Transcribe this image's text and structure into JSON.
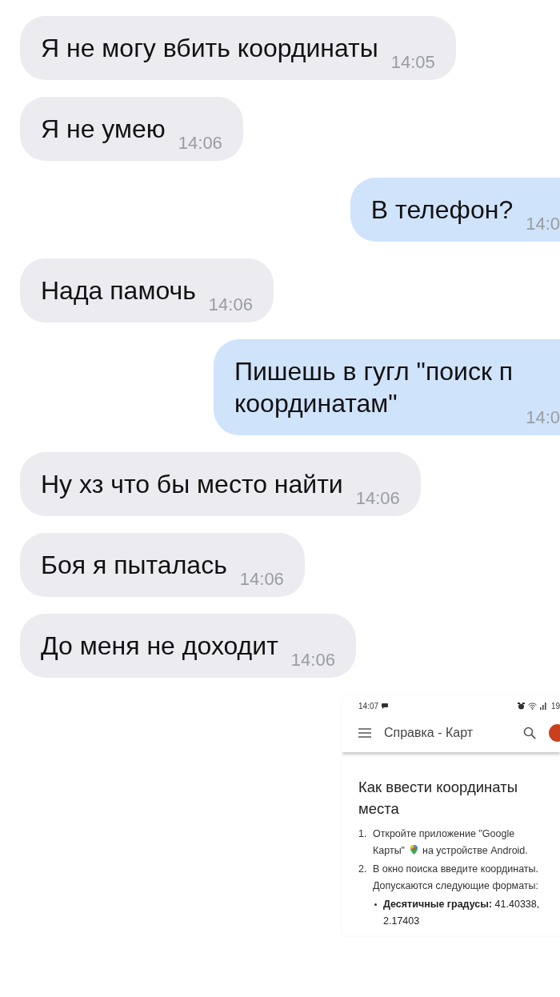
{
  "messages": [
    {
      "kind": "incoming",
      "lines": [
        "Я не могу вбить координаты"
      ],
      "time": "14:05"
    },
    {
      "kind": "incoming",
      "lines": [
        "Я не умею"
      ],
      "time": "14:06"
    },
    {
      "kind": "outgoing",
      "lines": [
        "В телефон?"
      ],
      "time": "14:0"
    },
    {
      "kind": "incoming",
      "lines": [
        "Нада памочь"
      ],
      "time": "14:06"
    },
    {
      "kind": "outgoing",
      "lines": [
        "Пишешь в гугл \"поиск п",
        "координатам\""
      ],
      "time": "14:0"
    },
    {
      "kind": "incoming",
      "lines": [
        "Ну хз что бы место найти"
      ],
      "time": "14:06"
    },
    {
      "kind": "incoming",
      "lines": [
        "Боя я пыталась"
      ],
      "time": "14:06"
    },
    {
      "kind": "incoming",
      "lines": [
        "До меня не доходит"
      ],
      "time": "14:06"
    }
  ],
  "attachment": {
    "kind": "screenshot",
    "status_bar": {
      "time": "14:07",
      "battery": "19"
    },
    "app_bar": {
      "title": "Справка - Карт"
    },
    "article": {
      "title": "Как ввести координаты места",
      "steps": [
        {
          "number": "1.",
          "text": "Откройте приложение \"Google",
          "text_before_icon": "Карты\"",
          "text_after_icon": "на устройстве Android."
        },
        {
          "number": "2.",
          "text": "В окно поиска введите координаты. Допускаются следующие форматы:",
          "bullets": [
            "**Десятичные градусы:** 41.40338, 2.17403"
          ]
        }
      ]
    }
  }
}
